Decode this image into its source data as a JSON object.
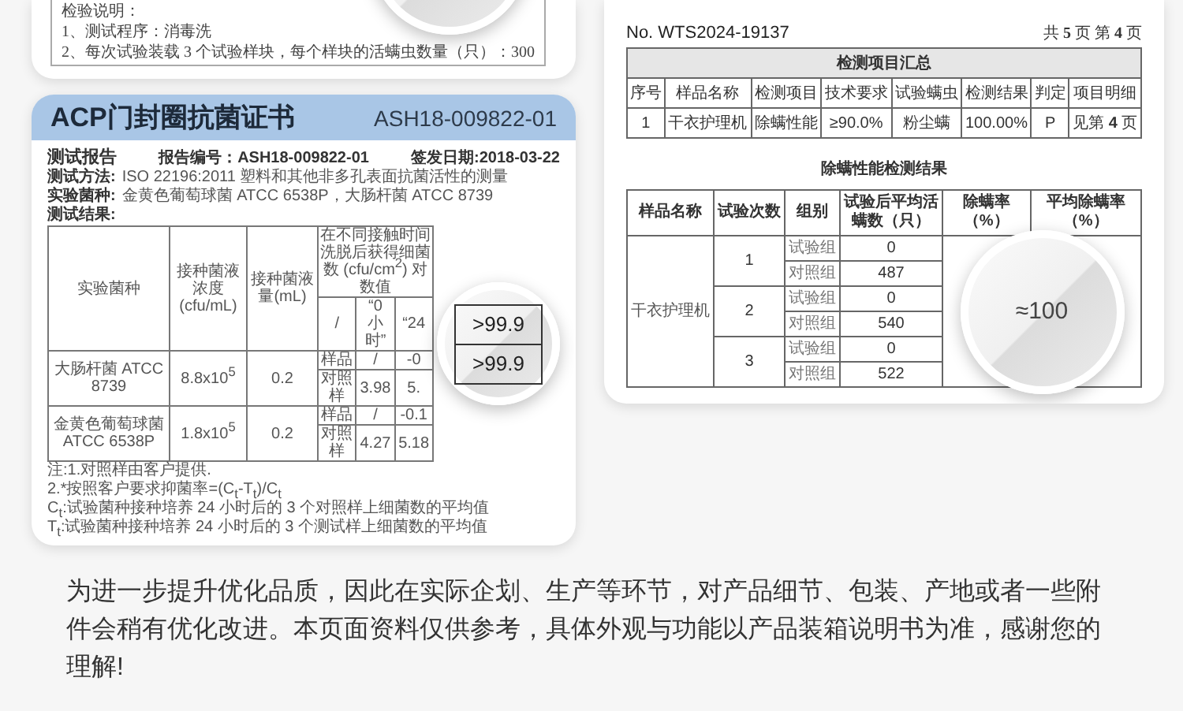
{
  "top_note": {
    "lines": [
      "检验说明：",
      "1、测试程序：消毒洗",
      "2、每次试验装载 3 个试验样块，每个样块的活螨虫数量（只）：300"
    ]
  },
  "certificate": {
    "title": "ACP门封圈抗菌证书",
    "number": "ASH18-009822-01",
    "heading": "测试报告",
    "report_no": "报告编号：ASH18-009822-01",
    "date": "签发日期:2018-03-22",
    "sections": [
      {
        "label": "测试方法:",
        "text": "ISO 22196:2011 塑料和其他非多孔表面抗菌活性的测量"
      },
      {
        "label": "实验菌种:",
        "text": "金黄色葡萄球菌 ATCC 6538P，大肠杆菌 ATCC 8739"
      }
    ],
    "results_label": "测试结果:",
    "table": {
      "columns": [
        "实验菌种",
        "接种菌液浓度 (cfu/mL)",
        "接种菌液量(mL)",
        "在不同接触时间洗脱后获得细菌数 (cfu/cm$^{2}$) 对数值"
      ],
      "subcolumns": [
        "/",
        "“0 小时”",
        "“24"
      ],
      "rows": [
        {
          "strain": "大肠杆菌 ATCC 8739",
          "concentration": "8.8x10$^{5}$",
          "volume": "0.2",
          "samples": [
            {
              "label": "样品",
              "values": [
                "/",
                "-0"
              ]
            },
            {
              "label": "对照样",
              "values": [
                "3.98",
                "5."
              ]
            }
          ]
        },
        {
          "strain": "金黄色葡萄球菌 ATCC 6538P",
          "concentration": "1.8x10$^{5}$",
          "volume": "0.2",
          "samples": [
            {
              "label": "样品",
              "values": [
                "/",
                "-0.1"
              ]
            },
            {
              "label": "对照样",
              "values": [
                "4.27",
                "5.18"
              ]
            }
          ]
        }
      ]
    },
    "magnifier": [
      ">99.9",
      ">99.9"
    ],
    "notes": [
      "注:1.对照样由客户提供.",
      "2.*按照客户要求抑菌率=(C$_{t}$-T$_{t}$)/C$_{t}$",
      "C$_{t}$:试验菌种接种培养 24 小时后的 3 个对照样上细菌数的平均值",
      "T$_{t}$:试验菌种接种培养 24 小时后的 3 个测试样上细菌数的平均值"
    ]
  },
  "report": {
    "number": "No. WTS2024-19137",
    "page": "共 **5** 页 第 **4** 页",
    "summary": {
      "title": "检测项目汇总",
      "columns": [
        "序号",
        "样品名称",
        "检测项目",
        "技术要求",
        "试验螨虫",
        "检测结果",
        "判定",
        "项目明细"
      ],
      "rows": [
        [
          "1",
          "干衣护理机",
          "除螨性能",
          "≥90.0%",
          "粉尘螨",
          "100.00%",
          "P",
          "见第 **4** 页"
        ]
      ]
    },
    "results": {
      "title": "除螨性能检测结果",
      "columns": [
        "样品名称",
        "试验次数",
        "组别",
        "试验后平均活螨数（只）",
        "除螨率（%）",
        "平均除螨率（%）"
      ],
      "sample": "干衣护理机",
      "trials": [
        {
          "number": "1",
          "groups": [
            {
              "group": "试验组",
              "count": "0"
            },
            {
              "group": "对照组",
              "count": "487"
            }
          ]
        },
        {
          "number": "2",
          "groups": [
            {
              "group": "试验组",
              "count": "0"
            },
            {
              "group": "对照组",
              "count": "540"
            }
          ]
        },
        {
          "number": "3",
          "groups": [
            {
              "group": "试验组",
              "count": "0"
            },
            {
              "group": "对照组",
              "count": "522"
            }
          ]
        }
      ],
      "magnifier": "≈100"
    }
  },
  "disclaimer": "为进一步提升优化品质，因此在实际企划、生产等环节，对产品细节、包装、产地或者一些附件会稍有优化改进。本页面资料仅供参考，具体外观与功能以产品装箱说明书为准，感谢您的理解!"
}
